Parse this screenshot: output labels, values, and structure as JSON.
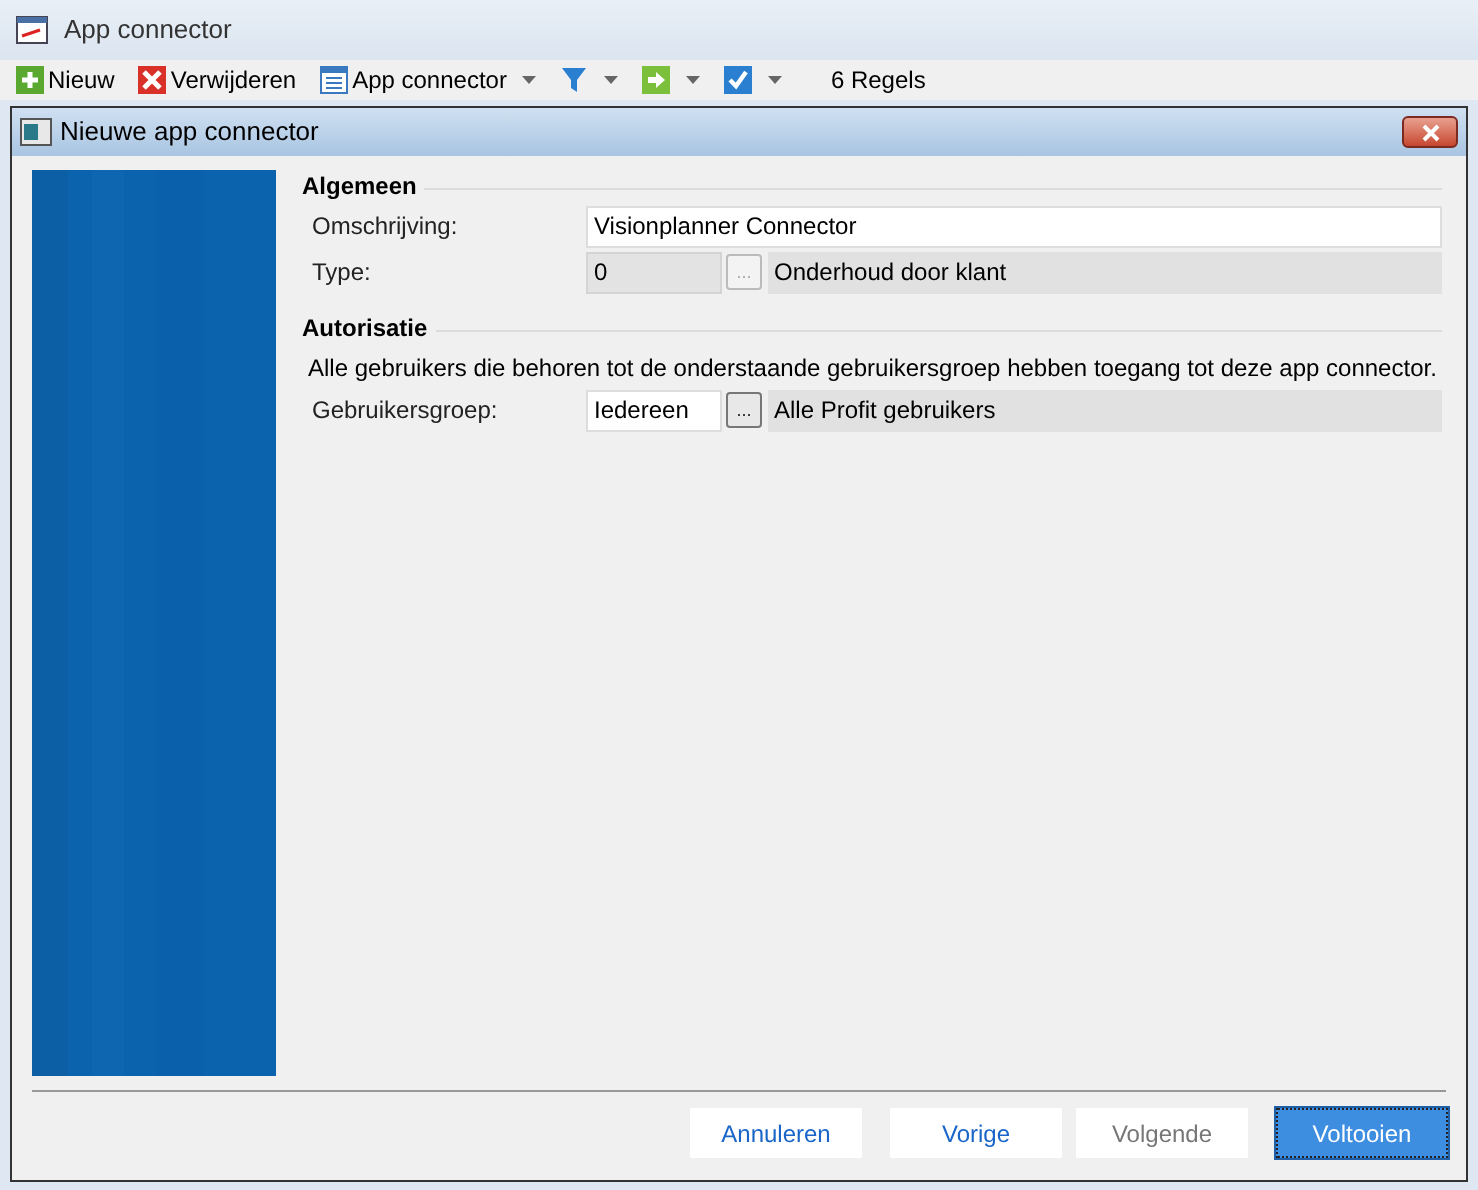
{
  "window": {
    "title": "App connector"
  },
  "toolbar": {
    "items": [
      {
        "kind": "plus",
        "label": "Nieuw",
        "dropdown": false
      },
      {
        "kind": "delete",
        "label": "Verwijderen",
        "dropdown": false
      },
      {
        "kind": "list",
        "label": "App connector",
        "dropdown": true
      },
      {
        "kind": "filter",
        "dropdown": true
      },
      {
        "kind": "arrow",
        "dropdown": true
      },
      {
        "kind": "check",
        "dropdown": true
      }
    ],
    "count": "6 Regels"
  },
  "dialog": {
    "title": "Nieuwe app connector",
    "sections": [
      {
        "title": "Algemeen",
        "fields": [
          {
            "kind": "text",
            "label": "Omschrijving:",
            "value": "Visionplanner Connector"
          },
          {
            "kind": "lookup",
            "label": "Type:",
            "value": "0",
            "disabled": true,
            "button": "...",
            "description": "Onderhoud door klant"
          }
        ]
      },
      {
        "title": "Autorisatie",
        "note": "Alle gebruikers die behoren tot de onderstaande gebruikersgroep hebben toegang tot deze app connector.",
        "fields": [
          {
            "kind": "lookup",
            "label": "Gebruikersgroep:",
            "value": "Iedereen",
            "disabled": false,
            "button": "...",
            "description": "Alle Profit gebruikers"
          }
        ]
      }
    ],
    "buttons": [
      {
        "label": "Annuleren",
        "disabled": false,
        "default": false
      },
      {
        "label": "Vorige",
        "disabled": false,
        "default": false
      },
      {
        "label": "Volgende",
        "disabled": true,
        "default": false
      },
      {
        "label": "Voltooien",
        "disabled": false,
        "default": true
      }
    ]
  }
}
